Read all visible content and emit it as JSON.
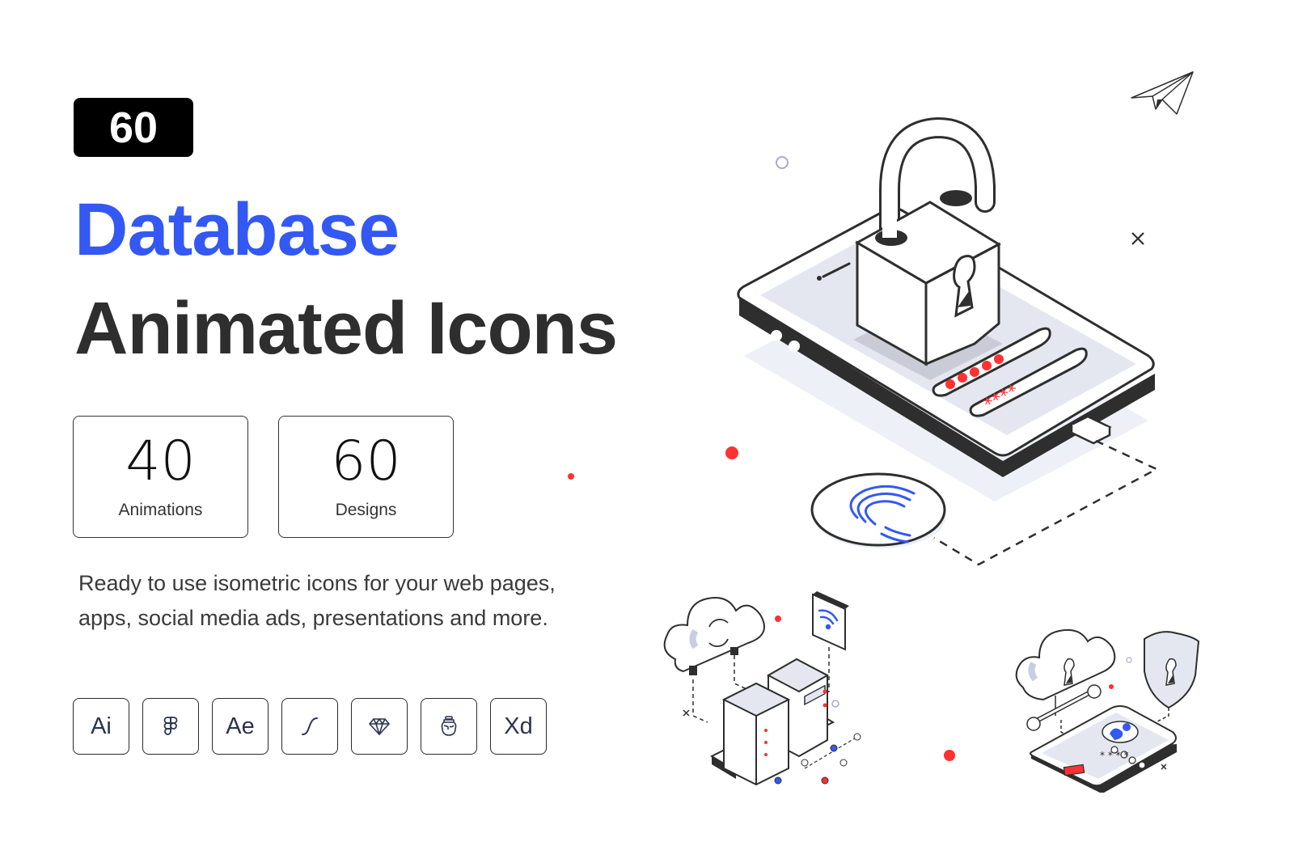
{
  "badge": {
    "count": "60"
  },
  "title": {
    "line1": "Database",
    "line2": "Animated Icons"
  },
  "stats": [
    {
      "value": "40",
      "label": "Animations"
    },
    {
      "value": "60",
      "label": "Designs"
    }
  ],
  "description": "Ready to use isometric icons for your web pages, apps, social media ads, presentations and more.",
  "tools": [
    {
      "name": "illustrator",
      "label": "Ai",
      "icon": "text"
    },
    {
      "name": "figma",
      "label": "",
      "icon": "figma-icon"
    },
    {
      "name": "after-effects",
      "label": "Ae",
      "icon": "text"
    },
    {
      "name": "lottie",
      "label": "",
      "icon": "lottie-icon"
    },
    {
      "name": "sketch",
      "label": "",
      "icon": "sketch-diamond-icon"
    },
    {
      "name": "iconjar",
      "label": "",
      "icon": "jar-icon"
    },
    {
      "name": "xd",
      "label": "Xd",
      "icon": "text"
    }
  ],
  "illustration": {
    "password_dots": "●●●●●",
    "password_stars": "****",
    "colors": {
      "accent_blue": "#3358f4",
      "accent_red": "#ff3131",
      "dark": "#2e2e2e",
      "screen": "#e4e7f0"
    }
  }
}
